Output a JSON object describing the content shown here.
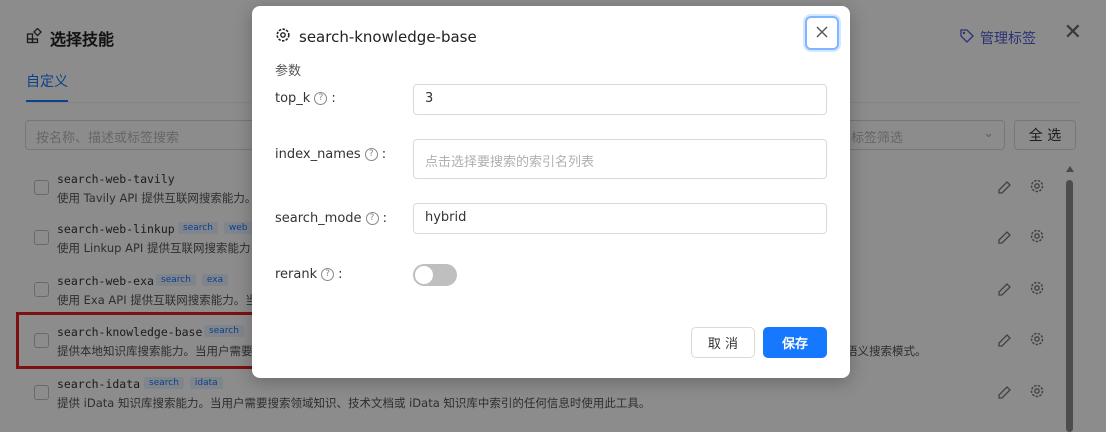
{
  "background": {
    "title": "选择技能",
    "manage_tags_label": "管理标签",
    "tab_custom": "自定义",
    "search_placeholder": "按名称、描述或标签搜索",
    "tag_filter_placeholder": "标签筛选",
    "select_all_label": "全 选",
    "skills": [
      {
        "name": "search-web-tavily",
        "tags": [],
        "desc": "使用 Tavily API 提供互联网搜索能力。"
      },
      {
        "name": "search-web-linkup",
        "tags": [
          "search",
          "web"
        ],
        "desc": "使用 Linkup API 提供互联网搜索能力"
      },
      {
        "name": "search-web-exa",
        "tags": [
          "search",
          "exa"
        ],
        "desc": "使用 Exa API 提供互联网搜索能力。当"
      },
      {
        "name": "search-knowledge-base",
        "tags": [
          "search"
        ],
        "desc": "提供本地知识库搜索能力。当用户需要"
      },
      {
        "name": "search-idata",
        "tags": [
          "search",
          "idata"
        ],
        "desc": "提供 iData 知识库搜索能力。当用户需要搜索领域知识、技术文档或 iData 知识库中索引的任何信息时使用此工具。"
      }
    ],
    "row4_trailing_text": "语义搜索模式。"
  },
  "modal": {
    "title": "search-knowledge-base",
    "section_label": "参数",
    "fields": {
      "top_k": {
        "label": "top_k",
        "value": "3"
      },
      "index_names": {
        "label": "index_names",
        "placeholder": "点击选择要搜索的索引名列表"
      },
      "search_mode": {
        "label": "search_mode",
        "value": "hybrid"
      },
      "rerank": {
        "label": "rerank",
        "enabled": false
      }
    },
    "cancel_label": "取 消",
    "save_label": "保存"
  },
  "colors": {
    "accent": "#1677ff",
    "highlight": "#e02020",
    "tag_bg": "#eaf2ff"
  }
}
